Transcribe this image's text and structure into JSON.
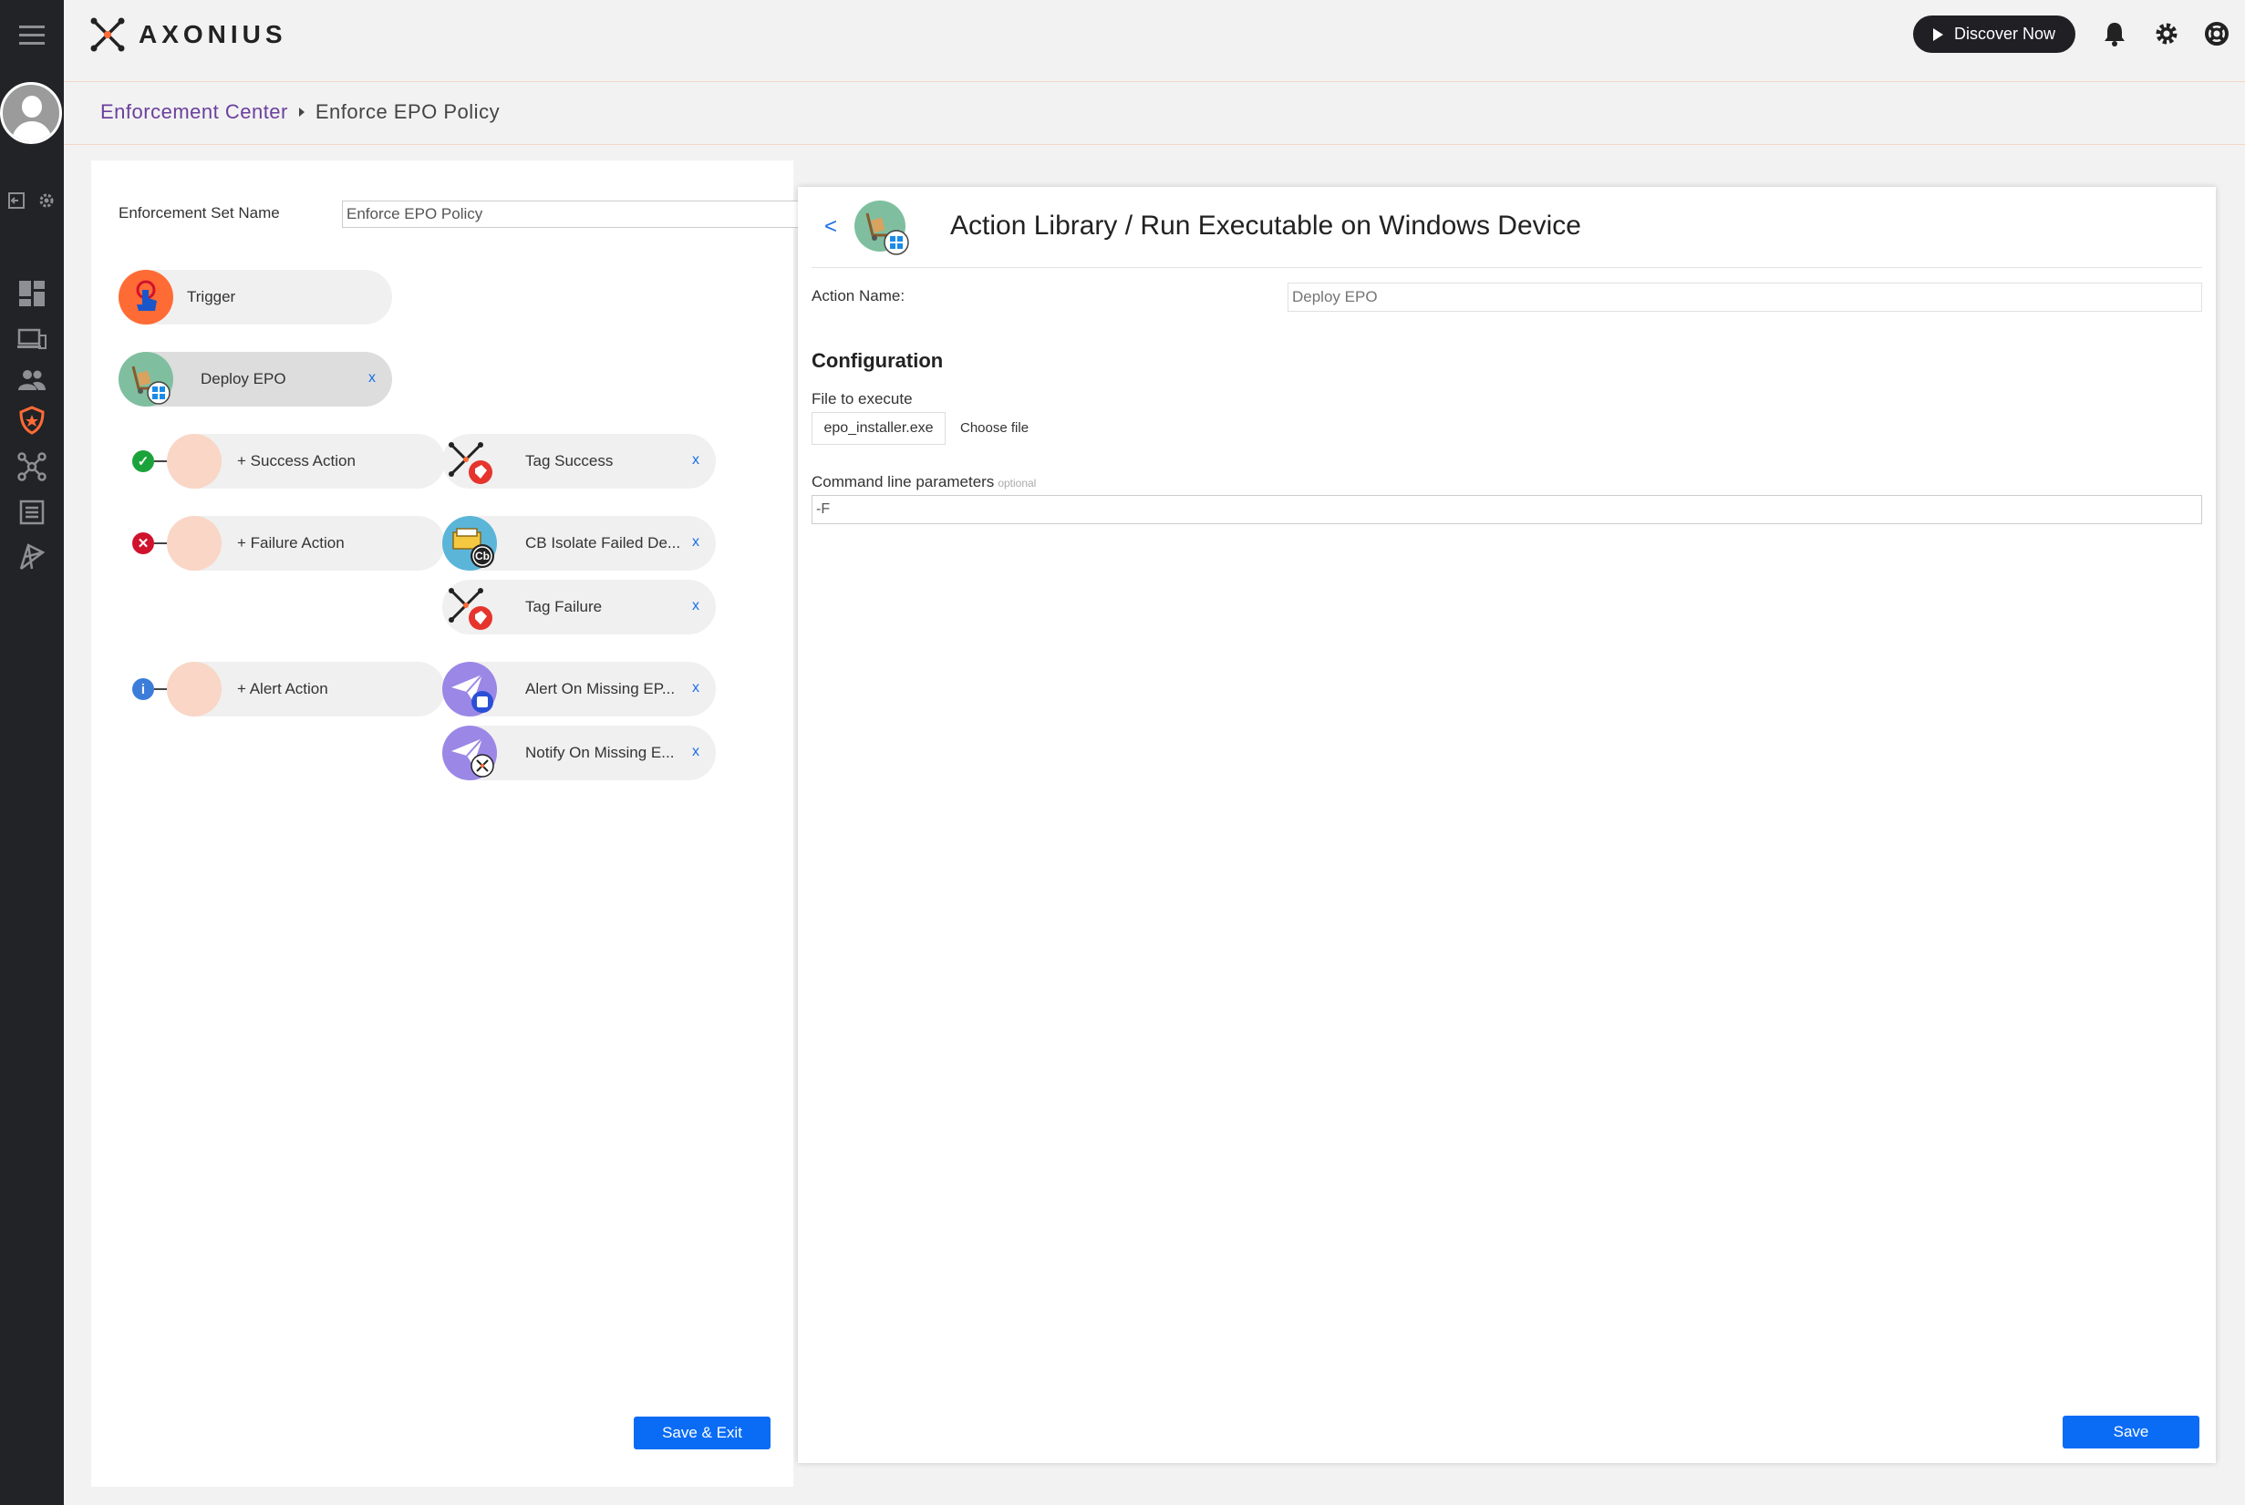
{
  "app": {
    "logo_text": "AXONIUS"
  },
  "topbar": {
    "discover_label": "Discover Now"
  },
  "breadcrumb": {
    "parent": "Enforcement Center",
    "current": "Enforce EPO Policy"
  },
  "enforcement_set": {
    "label": "Enforcement Set Name",
    "value": "Enforce EPO Policy"
  },
  "trigger": {
    "label": "Trigger"
  },
  "main_action": {
    "label": "Deploy EPO",
    "remove": "x"
  },
  "success": {
    "add_label": "+ Success Action",
    "actions": [
      {
        "label": "Tag Success",
        "remove": "x"
      }
    ]
  },
  "failure": {
    "add_label": "+ Failure Action",
    "actions": [
      {
        "label": "CB Isolate Failed De...",
        "remove": "x",
        "badge": "Cb"
      },
      {
        "label": "Tag Failure",
        "remove": "x"
      }
    ]
  },
  "alert": {
    "add_label": "+ Alert Action",
    "actions": [
      {
        "label": "Alert On Missing EP...",
        "remove": "x"
      },
      {
        "label": "Notify On Missing E...",
        "remove": "x"
      }
    ]
  },
  "left_footer": {
    "save_exit_label": "Save & Exit"
  },
  "action_panel": {
    "back_label": "<",
    "title": "Action Library / Run Executable on Windows Device",
    "action_name_label": "Action Name:",
    "action_name_placeholder": "Deploy EPO",
    "config_heading": "Configuration",
    "file_label": "File to execute",
    "file_value": "epo_installer.exe",
    "choose_file_label": "Choose file",
    "cmd_label": "Command line parameters",
    "cmd_optional": "optional",
    "cmd_value": "-F",
    "save_label": "Save"
  },
  "colors": {
    "accent": "#0a6cf5",
    "brand_orange": "#ff6b35",
    "sidebar_bg": "#222327",
    "breadcrumb_link": "#6b3f9c",
    "success": "#1aa33a",
    "failure": "#d0122d",
    "info": "#3b7dd8"
  }
}
